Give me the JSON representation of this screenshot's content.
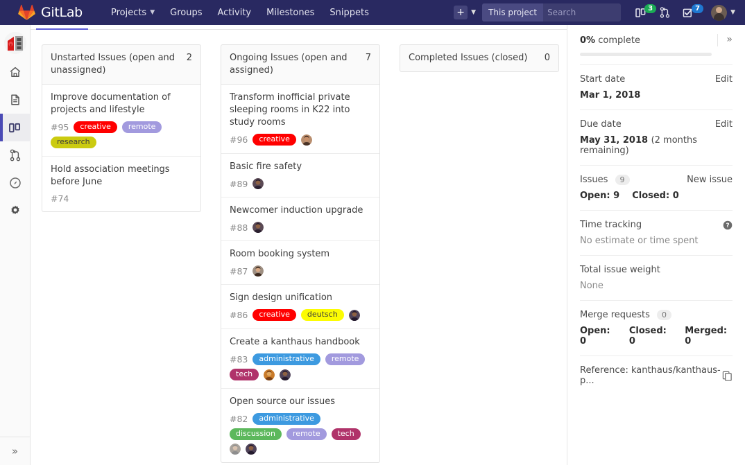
{
  "navbar": {
    "brand": "GitLab",
    "links": [
      {
        "label": "Projects",
        "has_caret": true
      },
      {
        "label": "Groups",
        "has_caret": false
      },
      {
        "label": "Activity",
        "has_caret": false
      },
      {
        "label": "Milestones",
        "has_caret": false
      },
      {
        "label": "Snippets",
        "has_caret": false
      }
    ],
    "plus_label": "+",
    "search": {
      "scope": "This project",
      "placeholder": "Search",
      "value": ""
    },
    "issues_badge": "3",
    "issues_badge_color": "#1aaa55",
    "todos_badge": "7",
    "todos_badge_color": "#1f78d1"
  },
  "sidebar": {
    "items": [
      {
        "name": "project-avatar",
        "label": "Project avatar",
        "active": false
      },
      {
        "name": "sidebar-item-overview",
        "label": "Overview",
        "active": false
      },
      {
        "name": "sidebar-item-repository",
        "label": "Repository",
        "active": false
      },
      {
        "name": "sidebar-item-issues",
        "label": "Issues",
        "active": true
      },
      {
        "name": "sidebar-item-merge-requests",
        "label": "Merge Requests",
        "active": false
      },
      {
        "name": "sidebar-item-cicd",
        "label": "CI / CD",
        "active": false
      },
      {
        "name": "sidebar-item-settings",
        "label": "Settings",
        "active": false
      }
    ],
    "collapse_label": "»"
  },
  "board": {
    "columns": [
      {
        "title": "Unstarted Issues (open and unassigned)",
        "count": "2",
        "cards": [
          {
            "title": "Improve documentation of projects and lifestyle",
            "id": "#95",
            "labels": [
              {
                "text": "creative",
                "color": "#ff0000"
              },
              {
                "text": "remote",
                "color": "#a29ade"
              },
              {
                "text": "research",
                "color": "#cbcb10"
              }
            ],
            "avatars": []
          },
          {
            "title": "Hold association meetings before June",
            "id": "#74",
            "labels": [],
            "avatars": []
          }
        ]
      },
      {
        "title": "Ongoing Issues (open and assigned)",
        "count": "7",
        "cards": [
          {
            "title": "Transform inofficial private sleeping rooms in K22 into study rooms",
            "id": "#96",
            "labels": [
              {
                "text": "creative",
                "color": "#ff0000"
              }
            ],
            "avatars": [
              {
                "skin": "#c8906a",
                "hair": "#4a3327",
                "bg": "#b98e6e"
              }
            ]
          },
          {
            "title": "Basic fire safety",
            "id": "#89",
            "labels": [],
            "avatars": [
              {
                "skin": "#8d6144",
                "hair": "#2b2030",
                "bg": "#5b4a55"
              }
            ]
          },
          {
            "title": "Newcomer induction upgrade",
            "id": "#88",
            "labels": [],
            "avatars": [
              {
                "skin": "#8d6144",
                "hair": "#2b2030",
                "bg": "#5b4a55"
              }
            ]
          },
          {
            "title": "Room booking system",
            "id": "#87",
            "labels": [],
            "avatars": [
              {
                "skin": "#d8a985",
                "hair": "#3d2a1e",
                "bg": "#9e8f82"
              }
            ]
          },
          {
            "title": "Sign design unification",
            "id": "#86",
            "labels": [
              {
                "text": "creative",
                "color": "#ff0000"
              },
              {
                "text": "deutsch",
                "color": "#fcfc03"
              }
            ],
            "avatars": [
              {
                "skin": "#8d6144",
                "hair": "#241a2e",
                "bg": "#4e4258"
              }
            ]
          },
          {
            "title": "Create a kanthaus handbook",
            "id": "#83",
            "labels": [
              {
                "text": "administrative",
                "color": "#3d9ae0"
              },
              {
                "text": "remote",
                "color": "#a29ade"
              },
              {
                "text": "tech",
                "color": "#b0336a"
              }
            ],
            "avatars": [
              {
                "skin": "#e0a860",
                "hair": "#7a3f12",
                "bg": "#c97b2a"
              },
              {
                "skin": "#8d6144",
                "hair": "#241a2e",
                "bg": "#4e4258"
              }
            ]
          },
          {
            "title": "Open source our issues",
            "id": "#82",
            "labels": [
              {
                "text": "administrative",
                "color": "#3d9ae0"
              },
              {
                "text": "discussion",
                "color": "#5cb85c"
              },
              {
                "text": "remote",
                "color": "#a29ade"
              },
              {
                "text": "tech",
                "color": "#b0336a"
              }
            ],
            "avatars": [
              {
                "skin": "#d9c3b0",
                "hair": "#8e8e8e",
                "bg": "#a9a39c"
              },
              {
                "skin": "#8d6144",
                "hair": "#241a2e",
                "bg": "#4e4258"
              }
            ]
          }
        ]
      },
      {
        "title": "Completed Issues (closed)",
        "count": "0",
        "cards": []
      }
    ]
  },
  "rightbar": {
    "progress_percent": "0%",
    "progress_suffix": "complete",
    "collapse_label": "»",
    "start_date": {
      "label": "Start date",
      "action": "Edit",
      "value": "Mar 1, 2018"
    },
    "due_date": {
      "label": "Due date",
      "action": "Edit",
      "value": "May 31, 2018",
      "remaining": "(2 months remaining)"
    },
    "issues": {
      "label": "Issues",
      "counter": "9",
      "action": "New issue",
      "open": "Open: 9",
      "closed": "Closed: 0"
    },
    "time_tracking": {
      "label": "Time tracking",
      "value": "No estimate or time spent"
    },
    "issue_weight": {
      "label": "Total issue weight",
      "value": "None"
    },
    "merge_requests": {
      "label": "Merge requests",
      "counter": "0",
      "open": "Open: 0",
      "closed": "Closed: 0",
      "merged": "Merged: 0"
    },
    "reference": "Reference: kanthaus/kanthaus-p..."
  }
}
